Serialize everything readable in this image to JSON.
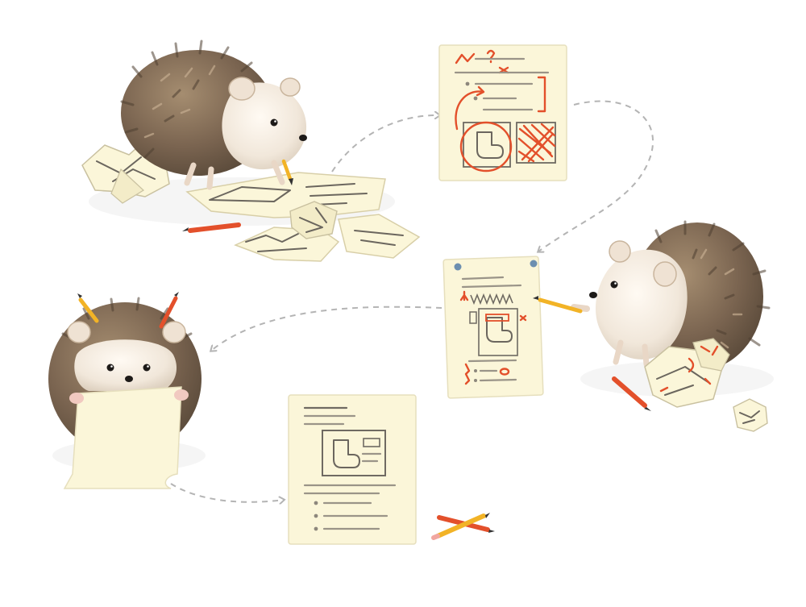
{
  "scene": {
    "subject": "hedgehog-design-process-illustration",
    "stages": [
      "sketching",
      "red-marked-draft",
      "revising-draft",
      "presenting",
      "final-draft"
    ]
  },
  "colors": {
    "paper": "#fbf6d9",
    "paper_edge": "#e6dfbd",
    "quill_dark": "#6e5a44",
    "quill_light": "#a58d70",
    "face": "#f4ece2",
    "red_pencil": "#e3502b",
    "yellow_pencil": "#f2b326",
    "arrow": "#b4b4b4",
    "background": "#ffffff"
  }
}
